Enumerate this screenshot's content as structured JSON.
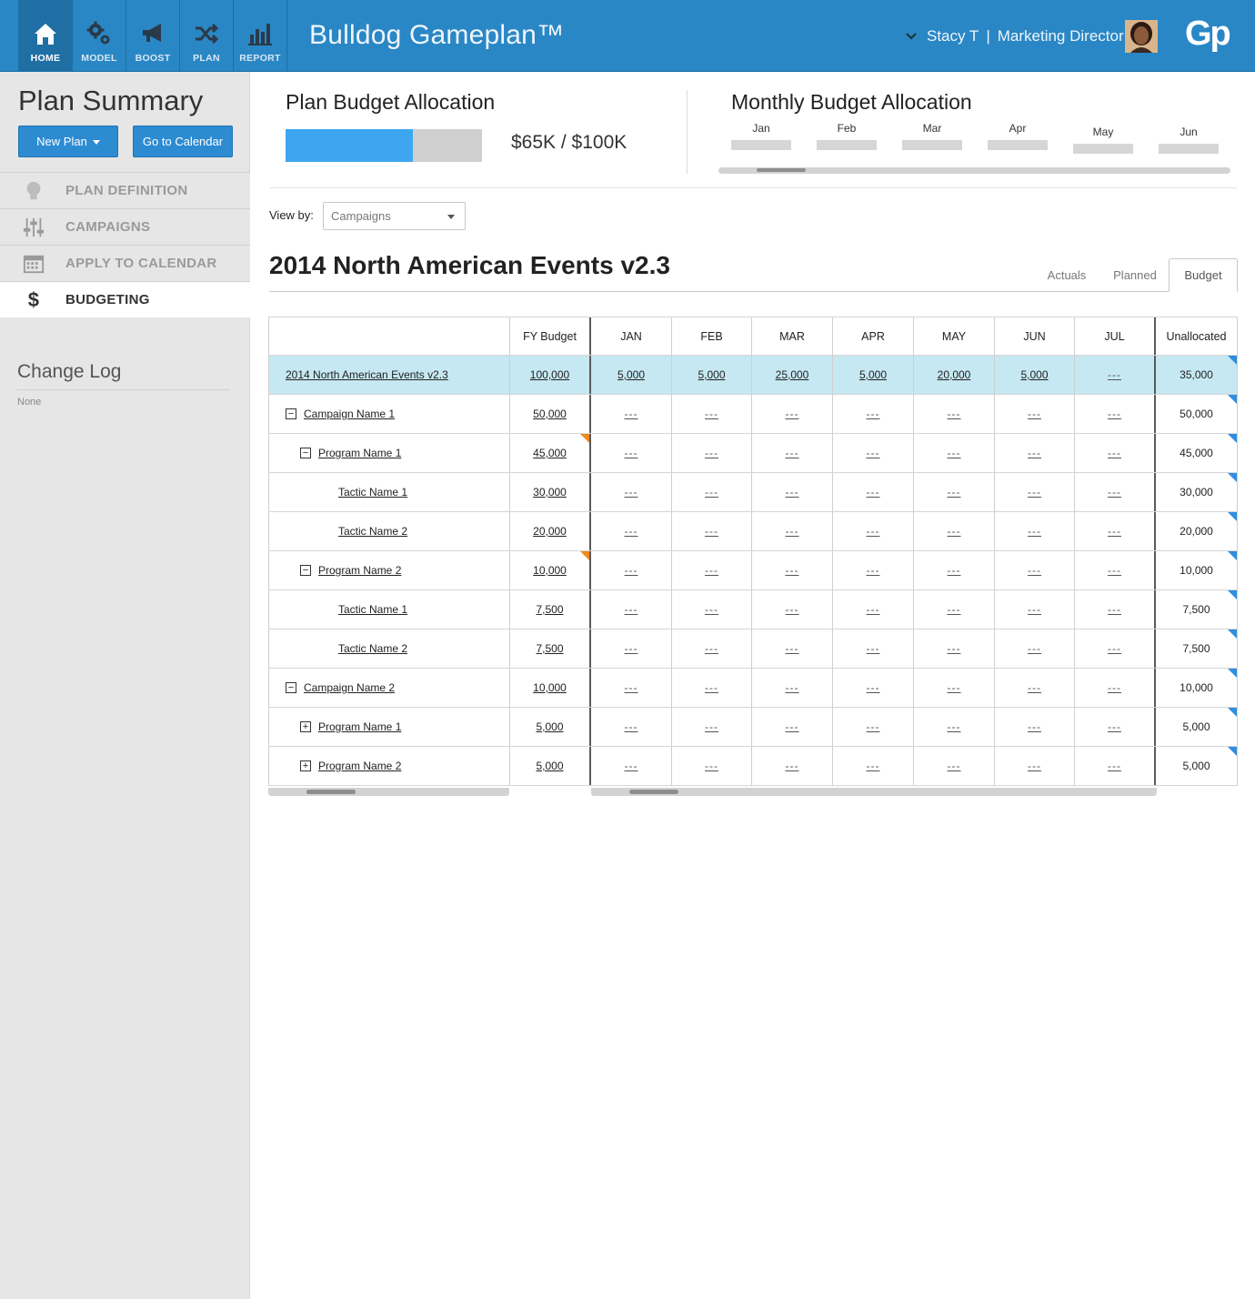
{
  "app": {
    "title": "Bulldog Gameplan™",
    "logo": "Gp",
    "nav": [
      {
        "label": "HOME",
        "icon": "home-icon",
        "active": true
      },
      {
        "label": "MODEL",
        "icon": "gears-icon"
      },
      {
        "label": "BOOST",
        "icon": "megaphone-icon"
      },
      {
        "label": "PLAN",
        "icon": "shuffle-icon"
      },
      {
        "label": "REPORT",
        "icon": "bar-chart-icon"
      }
    ],
    "user": {
      "name": "Stacy T",
      "separator": "|",
      "role": "Marketing Director"
    },
    "colors": {
      "header": "#2a87c5",
      "accent": "#3ea6f1",
      "button": "#2d8bd2"
    }
  },
  "sidebar": {
    "title": "Plan Summary",
    "new_plan": "New Plan",
    "go_to_calendar": "Go to Calendar",
    "menu": [
      {
        "label": "PLAN DEFINITION",
        "icon": "lightbulb-icon"
      },
      {
        "label": "CAMPAIGNS",
        "icon": "sliders-icon"
      },
      {
        "label": "APPLY TO CALENDAR",
        "icon": "calendar-icon"
      },
      {
        "label": "BUDGETING",
        "icon": "dollar-icon",
        "active": true
      }
    ],
    "change_log_title": "Change Log",
    "change_log_value": "None"
  },
  "summary": {
    "plan_budget_title": "Plan Budget Allocation",
    "allocated_fraction": 0.65,
    "budget_text": "$65K / $100K",
    "monthly_title": "Monthly Budget Allocation",
    "months": [
      "Jan",
      "Feb",
      "Mar",
      "Apr",
      "May",
      "Jun"
    ]
  },
  "view": {
    "label": "View by:",
    "selected": "Campaigns"
  },
  "plan": {
    "title": "2014 North American Events v2.3",
    "tabs": [
      "Actuals",
      "Planned",
      "Budget"
    ],
    "active_tab": "Budget"
  },
  "table": {
    "headers": {
      "fy_budget": "FY Budget",
      "months": [
        "JAN",
        "FEB",
        "MAR",
        "APR",
        "MAY",
        "JUN",
        "JUL"
      ],
      "unallocated": "Unallocated"
    },
    "rows": [
      {
        "level": "plan",
        "name": "2014 North American Events v2.3",
        "fy": "100,000",
        "months": [
          "5,000",
          "5,000",
          "25,000",
          "5,000",
          "20,000",
          "5,000",
          "---"
        ],
        "unallocated": "35,000"
      },
      {
        "level": "campaign",
        "toggle": "−",
        "name": "Campaign Name 1",
        "fy": "50,000",
        "months": [
          "---",
          "---",
          "---",
          "---",
          "---",
          "---",
          "---"
        ],
        "unallocated": "50,000"
      },
      {
        "level": "program",
        "toggle": "−",
        "name": "Program Name 1",
        "fy": "45,000",
        "flag": true,
        "months": [
          "---",
          "---",
          "---",
          "---",
          "---",
          "---",
          "---"
        ],
        "unallocated": "45,000"
      },
      {
        "level": "tactic",
        "name": "Tactic Name 1",
        "fy": "30,000",
        "months": [
          "---",
          "---",
          "---",
          "---",
          "---",
          "---",
          "---"
        ],
        "unallocated": "30,000"
      },
      {
        "level": "tactic",
        "name": "Tactic Name 2",
        "fy": "20,000",
        "months": [
          "---",
          "---",
          "---",
          "---",
          "---",
          "---",
          "---"
        ],
        "unallocated": "20,000"
      },
      {
        "level": "program",
        "toggle": "−",
        "name": "Program Name 2",
        "fy": "10,000",
        "flag": true,
        "months": [
          "---",
          "---",
          "---",
          "---",
          "---",
          "---",
          "---"
        ],
        "unallocated": "10,000"
      },
      {
        "level": "tactic",
        "name": "Tactic Name 1",
        "fy": "7,500",
        "months": [
          "---",
          "---",
          "---",
          "---",
          "---",
          "---",
          "---"
        ],
        "unallocated": "7,500"
      },
      {
        "level": "tactic",
        "name": "Tactic Name 2",
        "fy": "7,500",
        "months": [
          "---",
          "---",
          "---",
          "---",
          "---",
          "---",
          "---"
        ],
        "unallocated": "7,500"
      },
      {
        "level": "campaign",
        "toggle": "−",
        "name": "Campaign Name 2",
        "fy": "10,000",
        "months": [
          "---",
          "---",
          "---",
          "---",
          "---",
          "---",
          "---"
        ],
        "unallocated": "10,000"
      },
      {
        "level": "program",
        "toggle": "+",
        "name": "Program Name 1",
        "fy": "5,000",
        "months": [
          "---",
          "---",
          "---",
          "---",
          "---",
          "---",
          "---"
        ],
        "unallocated": "5,000"
      },
      {
        "level": "program",
        "toggle": "+",
        "name": "Program Name 2",
        "fy": "5,000",
        "months": [
          "---",
          "---",
          "---",
          "---",
          "---",
          "---",
          "---"
        ],
        "unallocated": "5,000"
      }
    ]
  }
}
